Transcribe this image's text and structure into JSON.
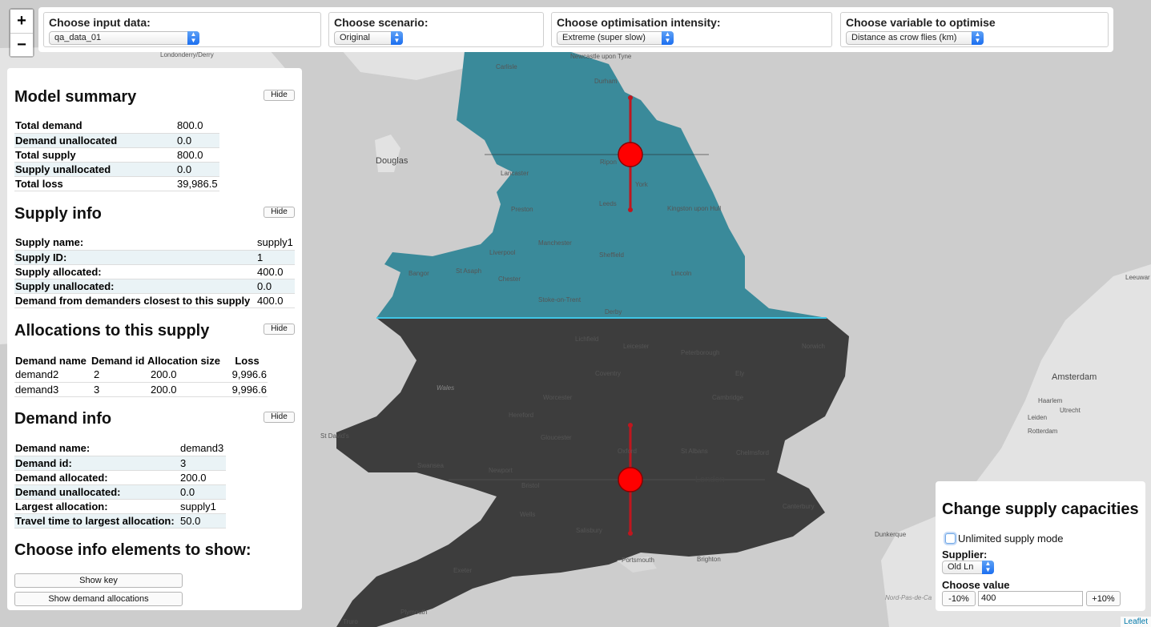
{
  "zoom": {
    "in_label": "+",
    "out_label": "−"
  },
  "selectors": {
    "input_data": {
      "title": "Choose input data:",
      "value": "qa_data_01"
    },
    "scenario": {
      "title": "Choose scenario:",
      "value": "Original"
    },
    "intensity": {
      "title": "Choose optimisation intensity:",
      "value": "Extreme (super slow)"
    },
    "variable": {
      "title": "Choose variable to optimise",
      "value": "Distance as crow flies (km)"
    }
  },
  "model_summary": {
    "title": "Model summary",
    "hide_label": "Hide",
    "rows": [
      {
        "k": "Total demand",
        "v": "800.0"
      },
      {
        "k": "Demand unallocated",
        "v": "0.0"
      },
      {
        "k": "Total supply",
        "v": "800.0"
      },
      {
        "k": "Supply unallocated",
        "v": "0.0"
      },
      {
        "k": "Total loss",
        "v": "39,986.5"
      }
    ]
  },
  "supply_info": {
    "title": "Supply info",
    "hide_label": "Hide",
    "rows": [
      {
        "k": "Supply name:",
        "v": "supply1"
      },
      {
        "k": "Supply ID:",
        "v": "1"
      },
      {
        "k": "Supply allocated:",
        "v": "400.0"
      },
      {
        "k": "Supply unallocated:",
        "v": "0.0"
      },
      {
        "k": "Demand from demanders closest to this supply",
        "v": "400.0"
      }
    ]
  },
  "allocations": {
    "title": "Allocations to this supply",
    "hide_label": "Hide",
    "headers": [
      "Demand name",
      "Demand id",
      "Allocation size",
      "Loss"
    ],
    "rows": [
      [
        "demand2",
        "2",
        "200.0",
        "9,996.6"
      ],
      [
        "demand3",
        "3",
        "200.0",
        "9,996.6"
      ]
    ]
  },
  "demand_info": {
    "title": "Demand info",
    "hide_label": "Hide",
    "rows": [
      {
        "k": "Demand name:",
        "v": "demand3"
      },
      {
        "k": "Demand id:",
        "v": "3"
      },
      {
        "k": "Demand allocated:",
        "v": "200.0"
      },
      {
        "k": "Demand unallocated:",
        "v": "0.0"
      },
      {
        "k": "Largest allocation:",
        "v": "supply1"
      },
      {
        "k": "Travel time to largest allocation:",
        "v": "50.0"
      }
    ]
  },
  "info_elements": {
    "title": "Choose info elements to show:",
    "show_key_label": "Show key",
    "show_alloc_label": "Show demand allocations"
  },
  "capacity": {
    "title": "Change supply capacities",
    "unlimited_label": "Unlimited supply mode",
    "supplier_label": "Supplier:",
    "supplier_value": "Old Ln",
    "choose_value_label": "Choose value",
    "minus_label": "-10%",
    "value": "400",
    "plus_label": "+10%"
  },
  "colors": {
    "supply_region": "#3a8a9a",
    "demand_region": "#3d3d3d",
    "marker": "#ff0000",
    "line": "#c0161e",
    "boundary": "#3fc6e6"
  },
  "map_labels": {
    "londonderry": "Londonderry/Derry",
    "newcastle": "Newcastle upon Tyne",
    "carlisle": "Carlisle",
    "durham": "Durham",
    "douglas": "Douglas",
    "lancaster": "Lancaster",
    "ripon": "Ripon",
    "york": "York",
    "preston": "Preston",
    "leeds": "Leeds",
    "hull": "Kingston upon Hull",
    "manchester": "Manchester",
    "liverpool": "Liverpool",
    "bangor": "Bangor",
    "stasaph": "St Asaph",
    "sheffield": "Sheffield",
    "lincoln": "Lincoln",
    "chester": "Chester",
    "stoke": "Stoke-on-Trent",
    "derby": "Derby",
    "lichfield": "Lichfield",
    "leicester": "Leicester",
    "peterborough": "Peterborough",
    "norwich": "Norwich",
    "coventry": "Coventry",
    "ely": "Ely",
    "wales": "Wales",
    "worcester": "Worcester",
    "cambridge": "Cambridge",
    "hereford": "Hereford",
    "stdavids": "St David's",
    "gloucester": "Gloucester",
    "oxford": "Oxford",
    "stalbans": "St Albans",
    "chelmsford": "Chelmsford",
    "swansea": "Swansea",
    "newport": "Newport",
    "bristol": "Bristol",
    "london": "London",
    "wells": "Wells",
    "canterbury": "Canterbury",
    "salisbury": "Salisbury",
    "portsmouth": "Portsmouth",
    "brighton": "Brighton",
    "exeter": "Exeter",
    "plymouth": "Plymouth",
    "truro": "Truro",
    "leeuwarden": "Leeuwar",
    "amsterdam": "Amsterdam",
    "utrecht": "Utrecht",
    "rotterdam": "Rotterdam",
    "dunkerque": "Dunkerque",
    "nordpasdecalais": "Nord-Pas-de-Ca",
    "leiden": "Leiden",
    "haarlem": "Haarlem"
  },
  "attribution": "Leaflet"
}
